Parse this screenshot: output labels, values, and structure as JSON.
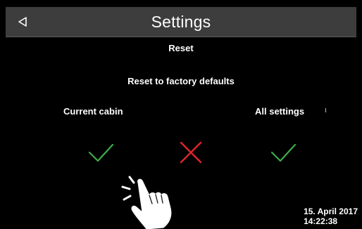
{
  "header": {
    "title": "Settings",
    "back_icon": "back-triangle-icon"
  },
  "reset": {
    "section_title": "Reset",
    "question": "Reset to factory defaults",
    "options": [
      {
        "label": "Current cabin",
        "icon": "check-icon",
        "color": "#3cae4a"
      },
      {
        "label": "",
        "icon": "cross-icon",
        "color": "#e0242b"
      },
      {
        "label": "All settings",
        "icon": "check-icon",
        "color": "#3cae4a"
      }
    ]
  },
  "status": {
    "date": "15. April 2017",
    "time": "14:22:38"
  },
  "colors": {
    "background": "#000000",
    "header": "#3d3d3d",
    "confirm": "#3cae4a",
    "cancel": "#e0242b"
  }
}
